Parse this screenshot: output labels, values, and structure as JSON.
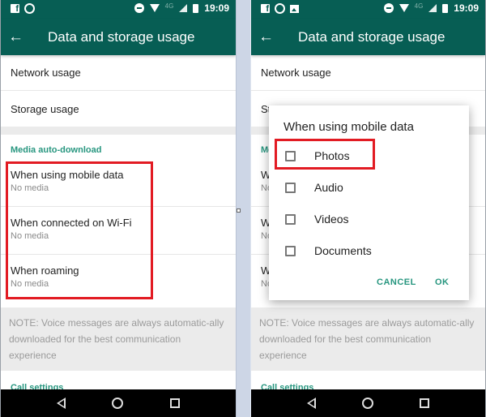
{
  "status_bar": {
    "time": "19:09",
    "network_label": "4G",
    "left_icons": [
      "facebook-icon",
      "whatsapp-icon"
    ],
    "right_icons": [
      "do-not-disturb-icon",
      "wifi-icon",
      "signal-icon",
      "battery-icon"
    ]
  },
  "app_bar": {
    "title": "Data and storage usage",
    "back_icon": "back-arrow-icon"
  },
  "settings": {
    "network_usage": "Network usage",
    "storage_usage": "Storage usage",
    "media_header": "Media auto-download",
    "media_items": [
      {
        "title": "When using mobile data",
        "subtitle": "No media"
      },
      {
        "title": "When connected on Wi-Fi",
        "subtitle": "No media"
      },
      {
        "title": "When roaming",
        "subtitle": "No media"
      }
    ],
    "note": "NOTE: Voice messages are always automatic-ally downloaded for the best communication experience",
    "call_header": "Call settings"
  },
  "dialog": {
    "title": "When using mobile data",
    "options": [
      {
        "label": "Photos",
        "checked": false
      },
      {
        "label": "Audio",
        "checked": false
      },
      {
        "label": "Videos",
        "checked": false
      },
      {
        "label": "Documents",
        "checked": false
      }
    ],
    "cancel_label": "CANCEL",
    "ok_label": "OK"
  },
  "nav_bar": {
    "icons": [
      "nav-back-icon",
      "nav-home-icon",
      "nav-recents-icon"
    ]
  },
  "colors": {
    "primary": "#075e54",
    "accent": "#27967f",
    "highlight": "#e21b23"
  }
}
